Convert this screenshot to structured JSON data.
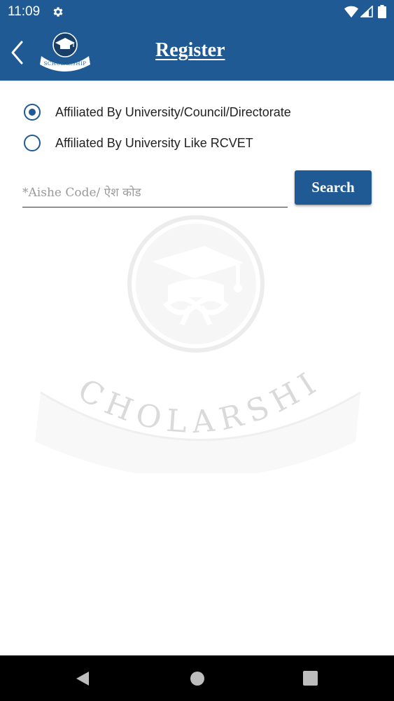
{
  "status_bar": {
    "time": "11:09",
    "icons": [
      "gear-icon",
      "wifi-icon",
      "cell-signal-icon",
      "battery-icon"
    ]
  },
  "app_bar": {
    "title": "Register",
    "back_icon": "chevron-left-icon",
    "logo_text": "SCHOLARSHIP"
  },
  "affiliation": {
    "options": [
      {
        "label": "Affiliated By University/Council/Directorate",
        "selected": true
      },
      {
        "label": "Affiliated By University Like RCVET",
        "selected": false
      }
    ]
  },
  "search": {
    "placeholder": "*Aishe Code/ ऐश कोड",
    "value": "",
    "button_label": "Search"
  },
  "watermark": {
    "text": "SCHOLARSHIP"
  },
  "nav_bar": {
    "icons": [
      "nav-back-icon",
      "nav-home-icon",
      "nav-recents-icon"
    ]
  },
  "colors": {
    "primary": "#1f5a94",
    "background": "#ffffff",
    "nav_bar": "#000000"
  }
}
